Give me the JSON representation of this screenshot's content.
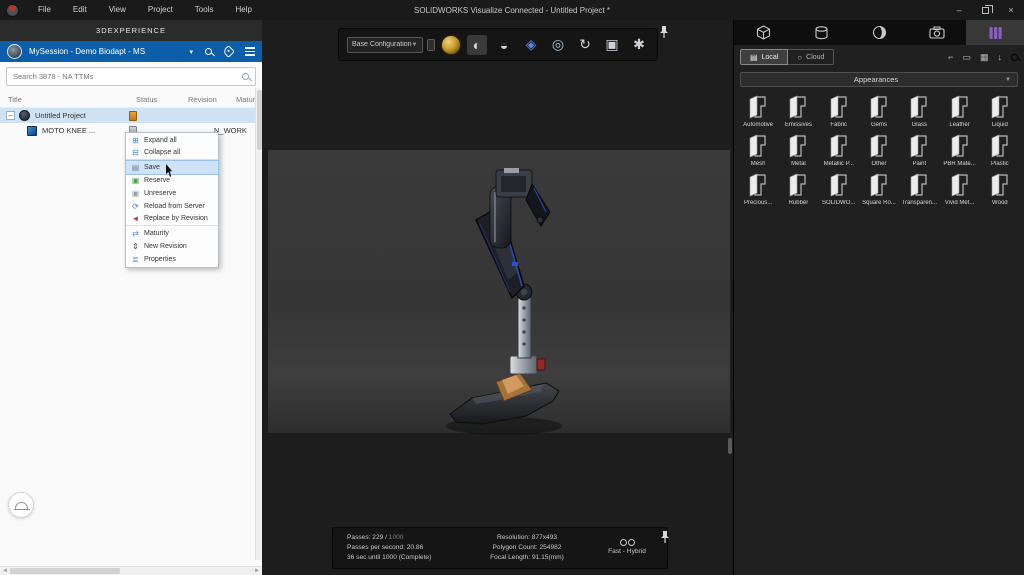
{
  "titlebar": {
    "menu": [
      "File",
      "Edit",
      "View",
      "Project",
      "Tools",
      "Help"
    ],
    "title": "SOLIDWORKS Visualize Connected - Untitled Project *",
    "minimize_glyph": "–",
    "close_glyph": "×"
  },
  "left_panel": {
    "header": "3DEXPERIENCE",
    "session": {
      "label": "MySession - Demo Biodapt - MS",
      "caret": "▾"
    },
    "search": {
      "placeholder": "Search 3878 - NA TTMs"
    },
    "columns": [
      "Title",
      "Status",
      "Revision",
      "Maturity"
    ],
    "tree": [
      {
        "expander": "−",
        "title": "Untitled Project"
      },
      {
        "title": "MOTO KNEE ...",
        "maturity": "N_WORK"
      }
    ],
    "context_menu": [
      {
        "name": "menu-expand-all",
        "glyph": "⊞",
        "color": "#4a7fc1",
        "label": "Expand all"
      },
      {
        "name": "menu-collapse-all",
        "glyph": "⊟",
        "color": "#4a7fc1",
        "label": "Collapse all",
        "cls": "sep"
      },
      {
        "name": "menu-save",
        "glyph": "▤",
        "color": "#6c82a0",
        "label": "Save",
        "cls": "hl"
      },
      {
        "name": "menu-reserve",
        "glyph": "▣",
        "color": "#4f9e4f",
        "label": "Reserve"
      },
      {
        "name": "menu-unreserve",
        "glyph": "▣",
        "color": "#98a1ab",
        "label": "Unreserve"
      },
      {
        "name": "menu-reload-from-server",
        "glyph": "⟳",
        "color": "#4a7fc1",
        "label": "Reload from Server"
      },
      {
        "name": "menu-replace-by-revision",
        "glyph": "◄",
        "color": "#b5413a",
        "label": "Replace by Revision",
        "cls": "sep"
      },
      {
        "name": "menu-maturity",
        "glyph": "⇄",
        "color": "#4a7fc1",
        "label": "Maturity"
      },
      {
        "name": "menu-new-revision",
        "glyph": "⇕",
        "color": "#444444",
        "label": "New Revision"
      },
      {
        "name": "menu-properties",
        "glyph": "≣",
        "color": "#4a7fc1",
        "label": "Properties"
      }
    ]
  },
  "viewport": {
    "toolbar": {
      "config_label": "Base Configuration",
      "caret": "▼",
      "icons": [
        {
          "name": "appearance-filter-icon",
          "cls": "gold",
          "glyph": ""
        },
        {
          "name": "compare-split-icon",
          "cls": "sel",
          "glyph": "◐"
        },
        {
          "name": "environment-icon",
          "glyph": "◒"
        },
        {
          "name": "model-icon",
          "glyph": "◈",
          "color": "#5b87d6"
        },
        {
          "name": "render-preview-icon",
          "glyph": "◎",
          "color": "#9fc0da"
        },
        {
          "name": "turntable-icon",
          "glyph": "↻"
        },
        {
          "name": "camera-views-icon",
          "glyph": "▣"
        },
        {
          "name": "aperture-icon",
          "glyph": "✱"
        }
      ]
    },
    "status": {
      "passes_label": "Passes: 229 /",
      "passes_total": "1000",
      "passes_per_second": "Passes per second: 20.86",
      "eta": "36 sec until 1000 (Complete)",
      "resolution": "Resolution: 877x493",
      "polygon_count": "Polygon Count: 254982",
      "focal_length": "Focal Length: 91.15(mm)",
      "mode": "Fast - Hybrid"
    }
  },
  "right_panel": {
    "tabs": [
      "models",
      "materials",
      "environments",
      "cameras",
      "library"
    ],
    "source_toggle": {
      "local": "Local",
      "cloud": "Cloud",
      "local_icon": "▤",
      "cloud_icon": "○"
    },
    "tool_icons": [
      {
        "name": "dock-icon",
        "glyph": "⌐"
      },
      {
        "name": "panel-view-icon",
        "glyph": "▭"
      },
      {
        "name": "grid-view-icon",
        "glyph": "▦"
      },
      {
        "name": "sort-icon",
        "glyph": "↓"
      }
    ],
    "dropdown": {
      "label": "Appearances",
      "caret": "▼"
    },
    "folders": [
      "Automotive",
      "Emissives",
      "Fabric",
      "Gems",
      "Glass",
      "Leather",
      "Liquid",
      "Mesh",
      "Metal",
      "Metallic P...",
      "Other",
      "Paint",
      "PBR Mate...",
      "Plastic",
      "Precious...",
      "Rubber",
      "SOLIDWO...",
      "Square Ro...",
      "Transparen...",
      "Vivid Met...",
      "Wood"
    ]
  },
  "colors": {
    "accent_blue": "#0d5ea8",
    "selection_blue": "#cfe2f4",
    "gold": "#c79b2e",
    "library_purple": "#8b5fbf"
  }
}
